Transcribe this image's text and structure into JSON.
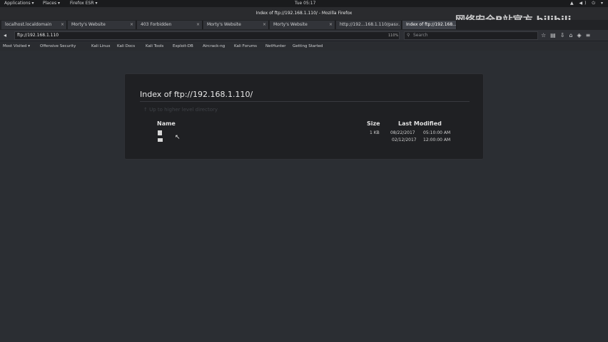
{
  "topbar": {
    "applications": "Applications ▾",
    "places": "Places ▾",
    "firefox": "Firefox ESR ▾",
    "clock": "Tue 05:17",
    "sys_icons": "▲ ◀) ⏻ ▾"
  },
  "window": {
    "title": "Index of ftp://192.168.1.110/ - Mozilla Firefox"
  },
  "tabs": [
    {
      "label": "localhost.localdomain",
      "active": false
    },
    {
      "label": "Morty's Website",
      "active": false
    },
    {
      "label": "403 Forbidden",
      "active": false
    },
    {
      "label": "Morty's Website",
      "active": false
    },
    {
      "label": "Morty's Website",
      "active": false
    },
    {
      "label": "http://192...168.1.110/pas...",
      "active": false
    },
    {
      "label": "Index of ftp://192.168...",
      "active": true
    }
  ],
  "navbar": {
    "url": "ftp://192.168.1.110",
    "zoom": "110%",
    "search_placeholder": "Search"
  },
  "bookmarks": [
    "Most Visited ▾",
    "Offensive Security",
    "Kali Linux",
    "Kali Docs",
    "Kali Tools",
    "Exploit-DB",
    "Aircrack-ng",
    "Kali Forums",
    "NetHunter",
    "Getting Started"
  ],
  "watermark": "网络安全B站官方 bilibili",
  "listing": {
    "title": "Index of ftp://192.168.1.110/",
    "parent_link": "Up to higher level directory",
    "columns": {
      "name": "Name",
      "size": "Size",
      "modified": "Last Modified"
    },
    "rows": [
      {
        "icon": "file-icon",
        "size": "1 KB",
        "date": "08/22/2017",
        "time": "05:10:00 AM"
      },
      {
        "icon": "folder-icon",
        "size": "",
        "date": "02/12/2017",
        "time": "12:00:00 AM"
      }
    ]
  }
}
